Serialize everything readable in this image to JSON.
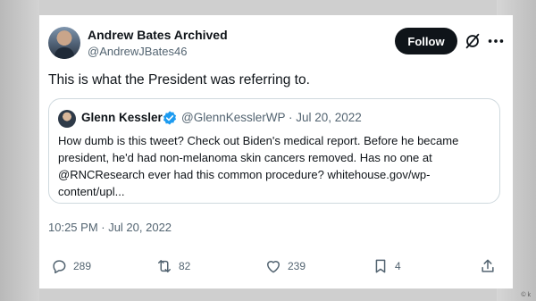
{
  "tweet": {
    "author_name": "Andrew Bates Archived",
    "author_handle": "@AndrewJBates46",
    "follow_label": "Follow",
    "text": "This is what the President was referring to.",
    "timestamp": "10:25 PM · Jul 20, 2022"
  },
  "quoted": {
    "author_name": "Glenn Kessler",
    "meta": "@GlennKesslerWP · Jul 20, 2022",
    "body": "How dumb is this tweet? Check out Biden's medical report. Before he became president, he'd had non-melanoma skin cancers removed. Has no one  at @RNCResearch ever had this common procedure?  whitehouse.gov/wp-content/upl..."
  },
  "actions": {
    "replies": "289",
    "reposts": "82",
    "likes": "239",
    "bookmarks": "4"
  },
  "icons": {
    "reply": "reply-icon",
    "repost": "repost-icon",
    "like": "heart-icon",
    "bookmark": "bookmark-icon",
    "share": "share-icon",
    "grok": "grok-icon",
    "more": "more-icon",
    "verified": "verified-badge-icon"
  },
  "colors": {
    "text": "#0f1419",
    "secondary": "#536471",
    "verified": "#1d9bf0",
    "follow_bg": "#0f1419"
  },
  "watermark": "© k"
}
